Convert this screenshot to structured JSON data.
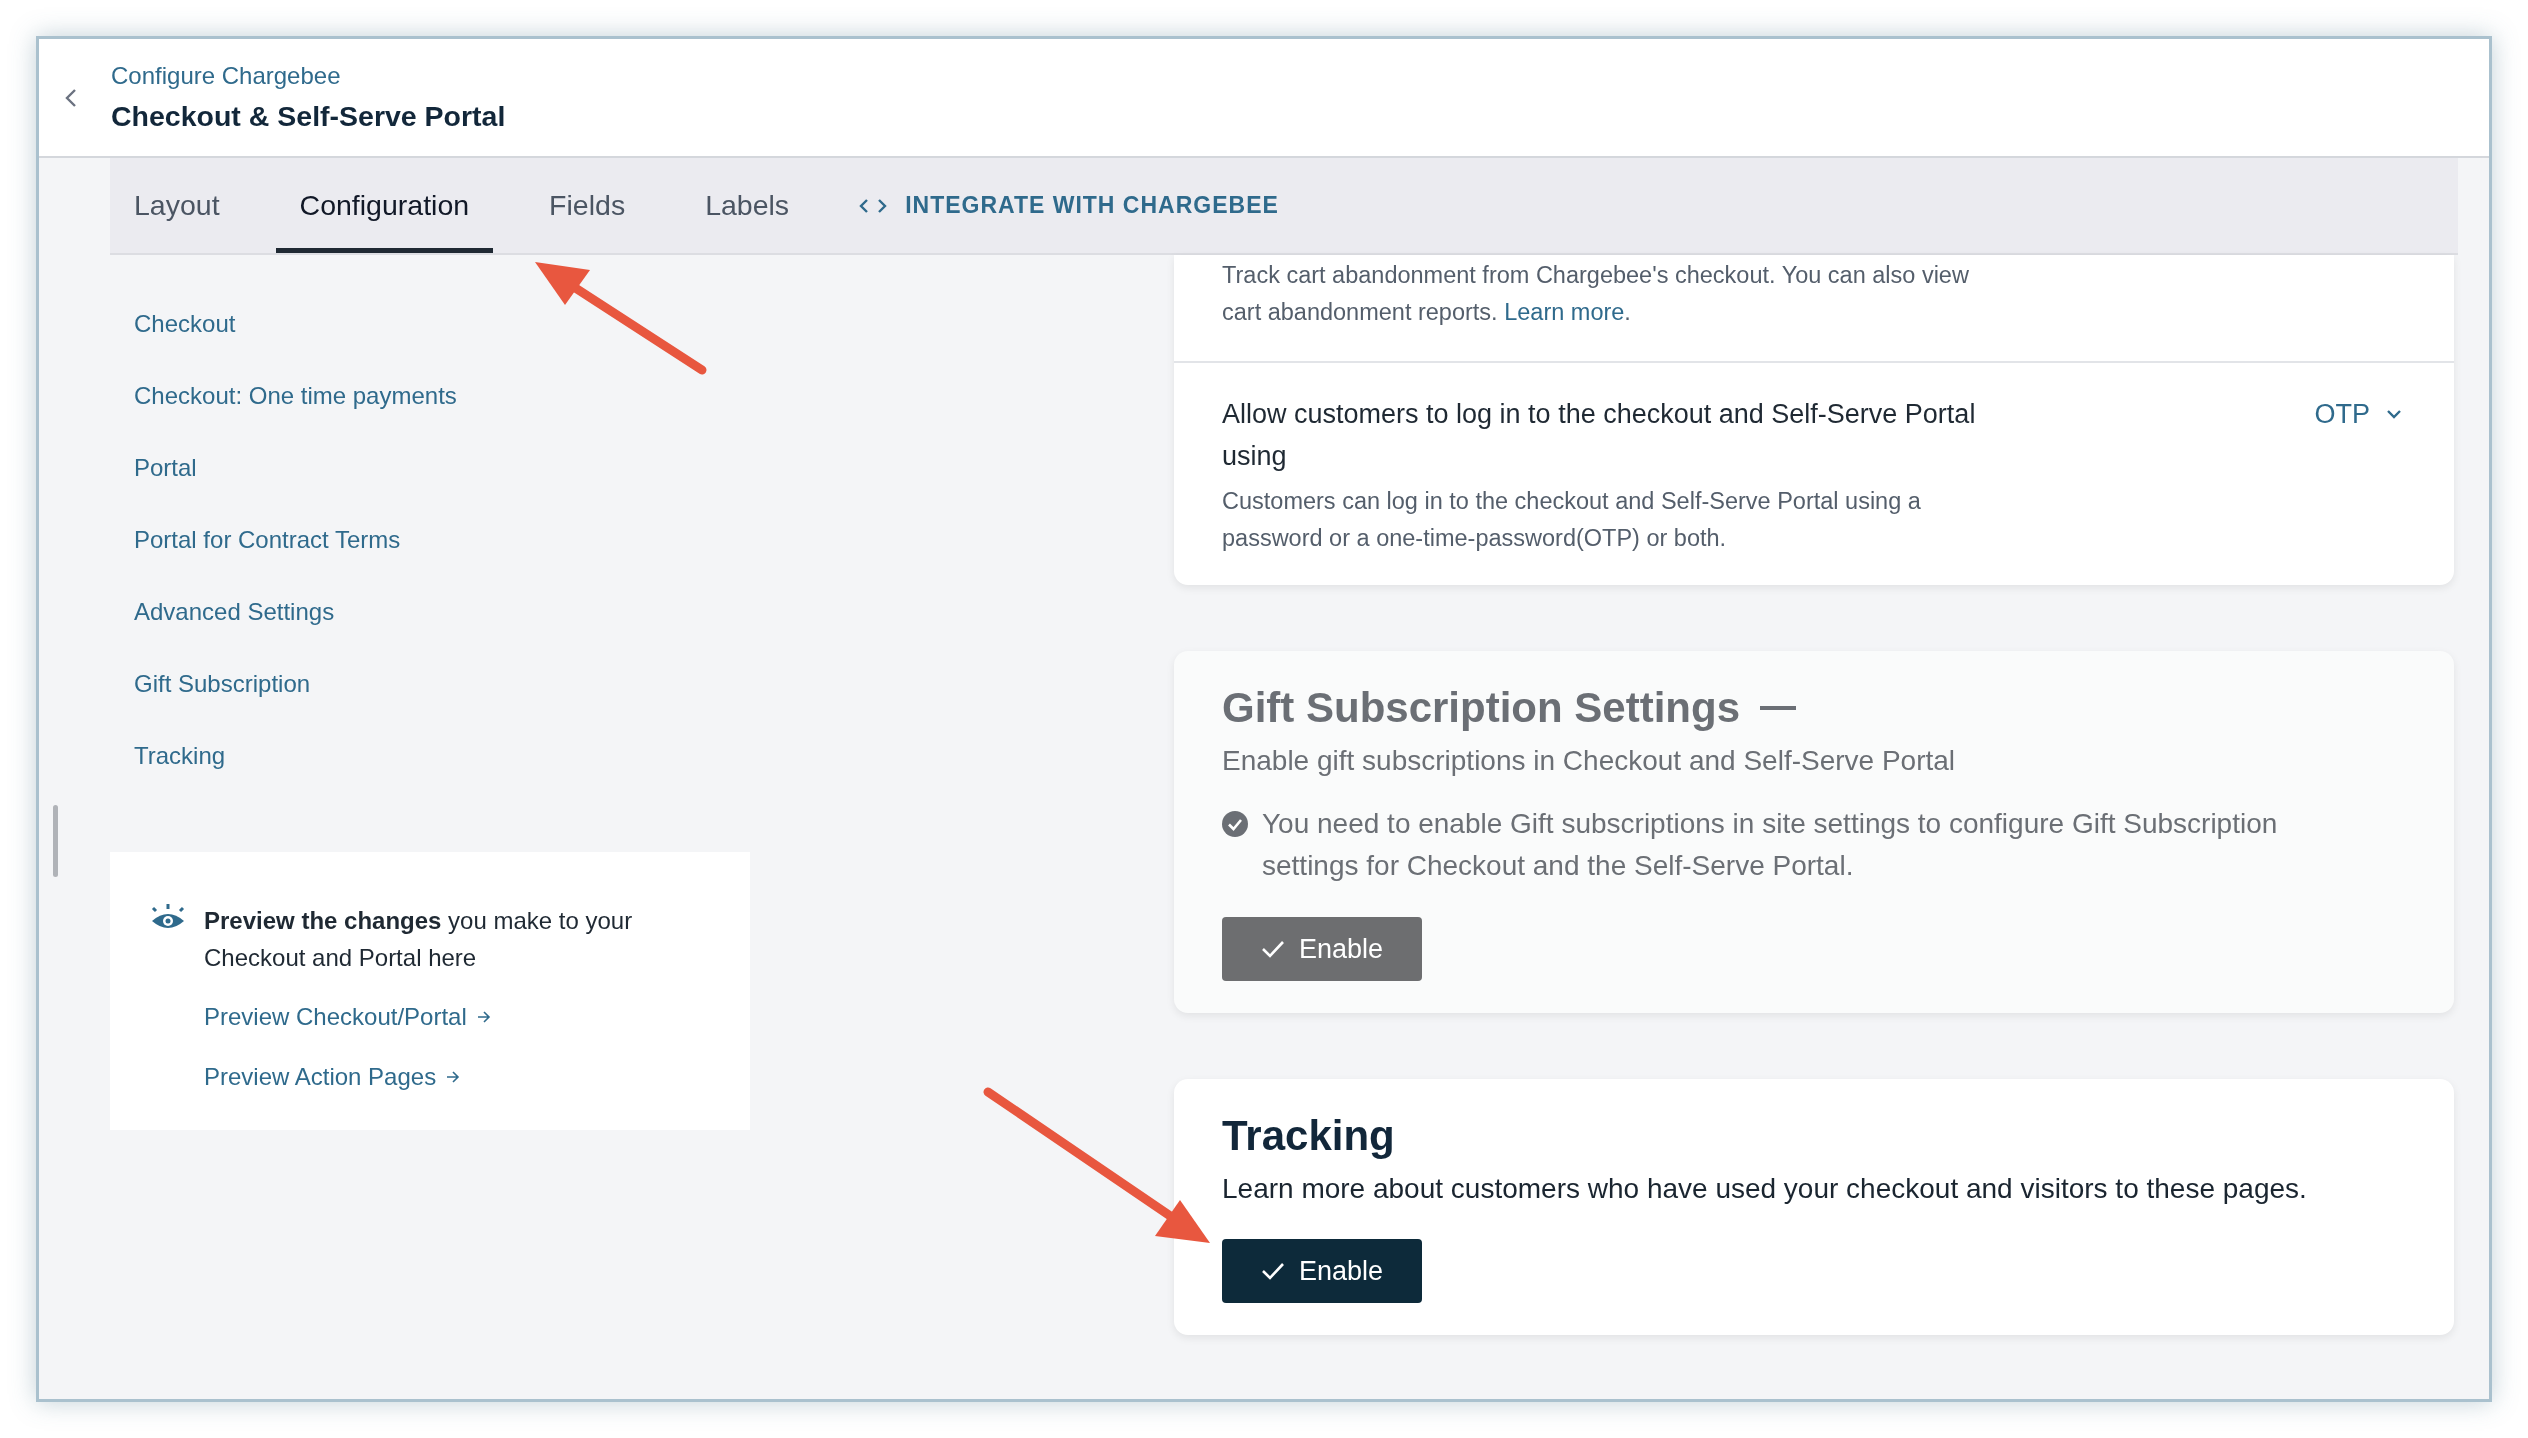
{
  "header": {
    "breadcrumb": "Configure Chargebee",
    "title": "Checkout & Self-Serve Portal"
  },
  "tabs": [
    {
      "label": "Layout",
      "selected": false,
      "kind": "tab"
    },
    {
      "label": "Configuration",
      "selected": true,
      "kind": "tab"
    },
    {
      "label": "Fields",
      "selected": false,
      "kind": "tab"
    },
    {
      "label": "Labels",
      "selected": false,
      "kind": "tab"
    },
    {
      "label": "INTEGRATE WITH CHARGEBEE",
      "selected": false,
      "kind": "action"
    }
  ],
  "sidebar": {
    "items": [
      "Checkout",
      "Checkout: One time payments",
      "Portal",
      "Portal for Contract Terms",
      "Advanced Settings",
      "Gift Subscription",
      "Tracking"
    ]
  },
  "preview_card": {
    "text": "**Preview the changes** you make to your Checkout and Portal here",
    "links": [
      "Preview Checkout/Portal",
      "Preview Action Pages"
    ]
  },
  "settings_card": {
    "rows": [
      {
        "kind": "text",
        "text": "Track cart abandonment from Chargebee's checkout. You can also view cart abandonment reports.",
        "link": "Learn more",
        "suffix": "."
      },
      {
        "kind": "dropdown",
        "title": "Allow customers to log in to the checkout and Self-Serve Portal using",
        "description": "Customers can log in to the checkout and Self-Serve Portal using a password or a one-time-password(OTP) or both.",
        "value": "OTP"
      }
    ]
  },
  "sections": [
    {
      "title": "Gift Subscription Settings",
      "collapsible": true,
      "disabled": true,
      "subtitle": "Enable gift subscriptions in Checkout and Self-Serve Portal",
      "notice": "You need to enable Gift subscriptions in site settings to configure Gift Subscription settings for Checkout and the Self-Serve Portal.",
      "button": "Enable"
    },
    {
      "title": "Tracking",
      "collapsible": false,
      "disabled": false,
      "subtitle": "Learn more about customers who have used your checkout and visitors to these pages.",
      "button": "Enable"
    }
  ]
}
